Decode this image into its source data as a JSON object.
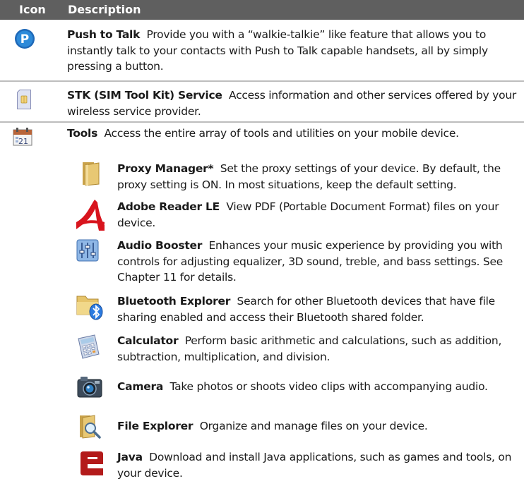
{
  "header": {
    "icon": "Icon",
    "description": "Description"
  },
  "rows": [
    {
      "icon": "push-to-talk-icon",
      "name": "Push to Talk",
      "desc": "Provide you with a “walkie-talkie” like feature that allows you to instantly talk to your contacts with Push to Talk capable handsets, all by simply pressing a button."
    },
    {
      "icon": "sim-card-icon",
      "name": "STK (SIM Tool Kit) Service",
      "desc": "Access information and other services offered by your wireless service provider."
    },
    {
      "icon": "calendar-tools-icon",
      "name": "Tools",
      "desc": "Access the entire array of tools and utilities on your mobile device."
    }
  ],
  "tools": [
    {
      "icon": "folder-icon",
      "name": "Proxy Manager*",
      "desc": "Set the proxy settings of your device. By default, the proxy setting is ON. In most situations, keep the default setting."
    },
    {
      "icon": "adobe-reader-icon",
      "name": "Adobe Reader LE",
      "desc": "View PDF (Portable Document Format) files on your device."
    },
    {
      "icon": "equalizer-icon",
      "name": "Audio Booster",
      "desc": "Enhances your music experience by providing you with controls for adjusting equalizer, 3D sound, treble, and bass settings. See Chapter 11 for details."
    },
    {
      "icon": "bluetooth-folder-icon",
      "name": "Bluetooth Explorer",
      "desc": "Search for other Bluetooth devices that have file sharing enabled and access their Bluetooth shared folder."
    },
    {
      "icon": "calculator-icon",
      "name": "Calculator",
      "desc": "Perform basic arithmetic and calculations, such as addition, subtraction, multiplication, and division."
    },
    {
      "icon": "camera-icon",
      "name": "Camera",
      "desc": "Take photos or shoots video clips with accompanying audio."
    },
    {
      "icon": "file-explorer-icon",
      "name": "File Explorer",
      "desc": "Organize and manage files on your device."
    },
    {
      "icon": "java-icon",
      "name": "Java",
      "desc": "Download and install Java applications, such as games and tools, on your device."
    }
  ]
}
